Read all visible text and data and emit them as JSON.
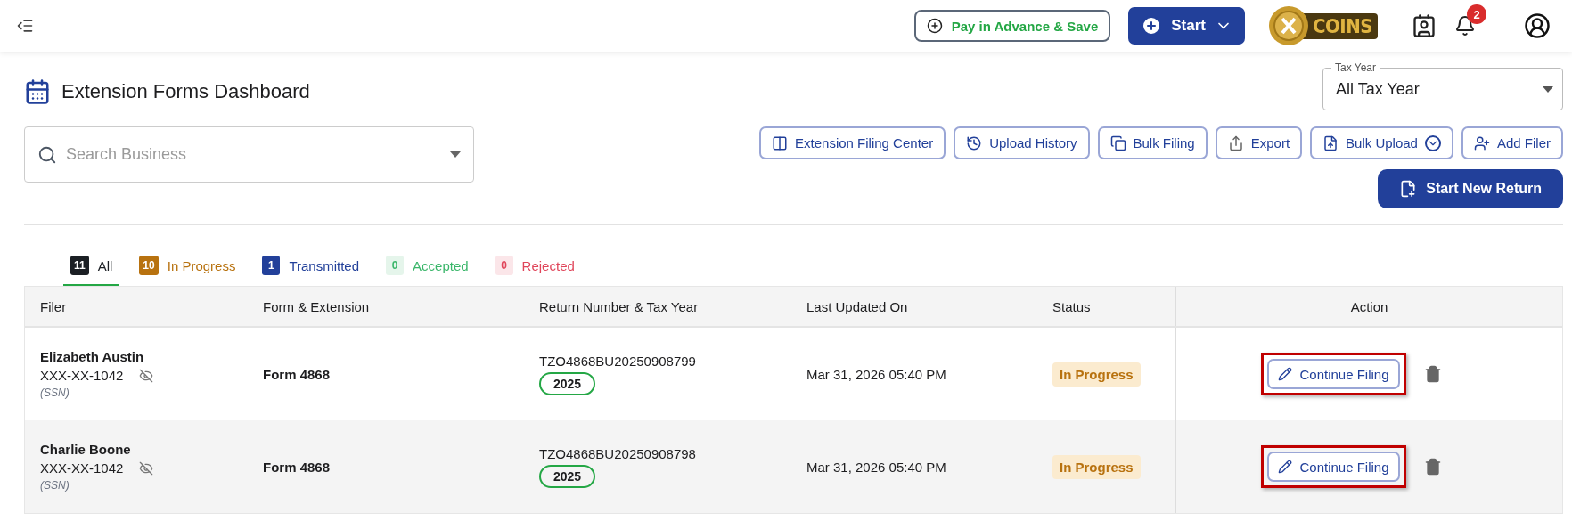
{
  "header": {
    "pay_button": "Pay in Advance & Save",
    "start_button": "Start",
    "coins_logo": "COINS",
    "notification_count": "2"
  },
  "page_title": "Extension Forms Dashboard",
  "tax_year": {
    "label": "Tax Year",
    "value": "All Tax Year"
  },
  "search": {
    "placeholder": "Search Business"
  },
  "toolbar": [
    "Extension Filing Center",
    "Upload History",
    "Bulk Filing",
    "Export",
    "Bulk Upload",
    "Add Filer"
  ],
  "start_new_return": "Start New Return",
  "tabs": [
    {
      "count": "11",
      "label": "All",
      "kind": "solid",
      "color": "#1b1f24",
      "selected": true
    },
    {
      "count": "10",
      "label": "In Progress",
      "kind": "solid",
      "color": "#b8720f",
      "selected": false
    },
    {
      "count": "1",
      "label": "Transmitted",
      "kind": "solid",
      "color": "#22409a",
      "selected": false
    },
    {
      "count": "0",
      "label": "Accepted",
      "kind": "soft",
      "color": "#3ab66a",
      "selected": false
    },
    {
      "count": "0",
      "label": "Rejected",
      "kind": "soft",
      "color": "#e0455a",
      "selected": false
    }
  ],
  "table": {
    "columns": [
      "Filer",
      "Form & Extension",
      "Return Number & Tax Year",
      "Last Updated On",
      "Status",
      "Action"
    ],
    "rows": [
      {
        "name": "Elizabeth Austin",
        "ssn": "XXX-XX-1042",
        "ssn_label": "(SSN)",
        "form": "Form 4868",
        "return_number": "TZO4868BU20250908799",
        "tax_year": "2025",
        "last_updated": "Mar 31, 2026 05:40 PM",
        "status": "In Progress",
        "action": "Continue Filing",
        "highlighted": true
      },
      {
        "name": "Charlie Boone",
        "ssn": "XXX-XX-1042",
        "ssn_label": "(SSN)",
        "form": "Form 4868",
        "return_number": "TZO4868BU20250908798",
        "tax_year": "2025",
        "last_updated": "Mar 31, 2026 05:40 PM",
        "status": "In Progress",
        "action": "Continue Filing",
        "highlighted": true
      }
    ]
  }
}
